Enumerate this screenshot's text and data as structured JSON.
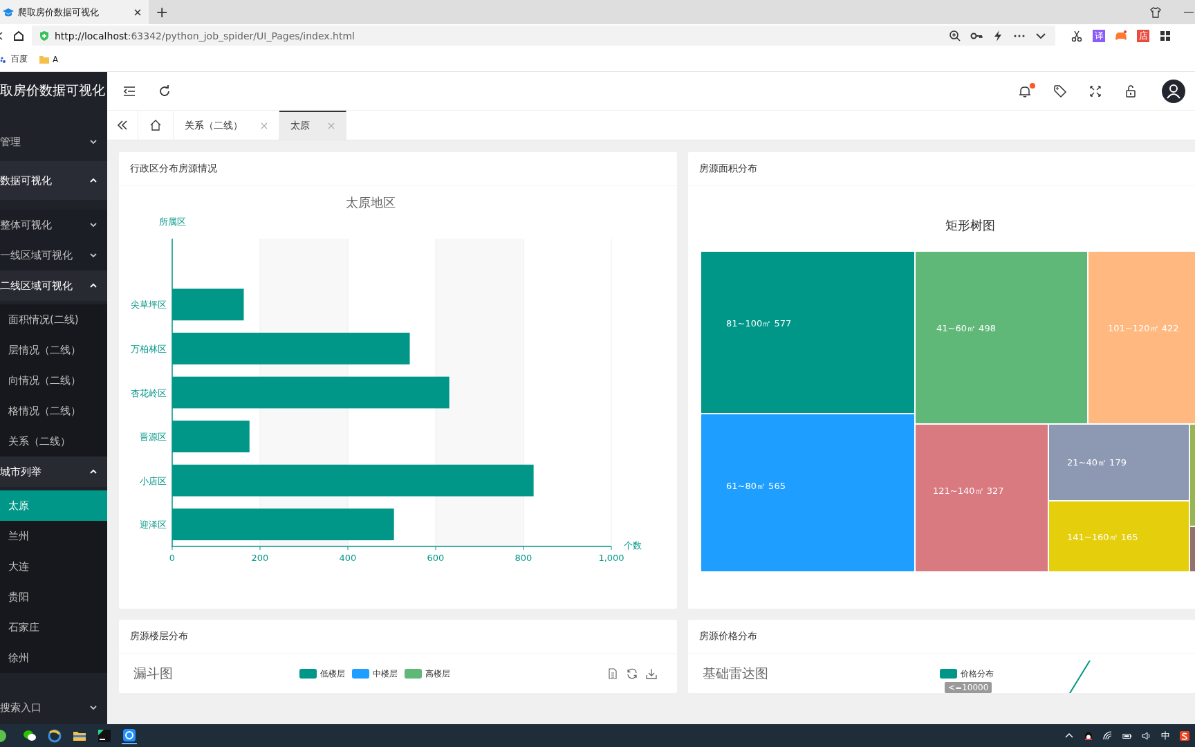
{
  "browser": {
    "tab_title": "爬取房价数据可视化",
    "new_tab": "+",
    "url_host": "http://localhost",
    "url_rest": ":63342/python_job_spider/UI_Pages/index.html",
    "extensions": [
      {
        "kind": "scissors"
      },
      {
        "kind": "text",
        "label": "译",
        "color": "#8b5cf6"
      },
      {
        "kind": "gamepad",
        "color": "#ff7a2f"
      },
      {
        "kind": "text",
        "label": "店",
        "color": "#e84c3d"
      },
      {
        "kind": "grid"
      }
    ],
    "bookmarks": [
      {
        "kind": "paw",
        "label": "百度"
      },
      {
        "kind": "folder",
        "label": "A"
      }
    ]
  },
  "sidebar": {
    "title": "取房价数据可视化",
    "menu": [
      {
        "label": "管理",
        "expanded": false
      },
      {
        "label": "数据可视化",
        "expanded": true,
        "children": [
          {
            "label": "整体可视化",
            "expanded": false
          },
          {
            "label": "一线区域可视化",
            "expanded": false
          },
          {
            "label": "二线区域可视化",
            "expanded": true,
            "children": [
              {
                "label": "面积情况(二线)",
                "selected": false
              },
              {
                "label": "层情况（二线）",
                "selected": false
              },
              {
                "label": "向情况（二线）",
                "selected": false
              },
              {
                "label": "格情况（二线）",
                "selected": false
              },
              {
                "label": "关系（二线）",
                "selected": false
              }
            ]
          },
          {
            "label": "城市列举",
            "expanded": true,
            "children": [
              {
                "label": "太原",
                "selected": true
              },
              {
                "label": "兰州",
                "selected": false
              },
              {
                "label": "大连",
                "selected": false
              },
              {
                "label": "贵阳",
                "selected": false
              },
              {
                "label": "石家庄",
                "selected": false
              },
              {
                "label": "徐州",
                "selected": false
              }
            ]
          }
        ]
      },
      {
        "label": "搜索入口",
        "expanded": false
      }
    ]
  },
  "header": {
    "unread_notifications": true
  },
  "tabs": [
    {
      "label": "关系（二线）",
      "selected": false
    },
    {
      "label": "太原",
      "selected": true
    }
  ],
  "panels": [
    {
      "kind": "bar",
      "title": "行政区分布房源情况",
      "chart_data": {
        "type": "bar",
        "orientation": "horizontal",
        "title": "太原地区",
        "xlabel": "个数",
        "annotations": [
          {
            "text": "所属区"
          }
        ],
        "color": "#009688",
        "categories": [
          "尖草坪区",
          "万柏林区",
          "杏花岭区",
          "晋源区",
          "小店区",
          "迎泽区"
        ],
        "values": [
          163,
          541,
          631,
          176,
          823,
          505
        ],
        "grid": true,
        "xlim": [
          0,
          1000
        ],
        "xticks": [
          0,
          200,
          400,
          600,
          800,
          {
            "value": 1000,
            "label": "1,000"
          }
        ]
      }
    },
    {
      "kind": "treemap",
      "title": "房源面积分布",
      "chart_title": "矩形树图",
      "items": [
        {
          "label": "81~100㎡ 577",
          "color": "#009688"
        },
        {
          "label": "61~80㎡ 565",
          "color": "#1e9fff"
        },
        {
          "label": "41~60㎡ 498",
          "color": "#5fb878"
        },
        {
          "label": "101~120㎡ 422",
          "color": "#ffb980"
        },
        {
          "label": "121~140㎡ 327",
          "color": "#d87a80"
        },
        {
          "label": "21~40㎡ 179",
          "color": "#8d98b3"
        },
        {
          "label": "141~160㎡ 165",
          "color": "#e5cf0d"
        },
        {
          "color": "#97b552"
        },
        {
          "color": "#95706d"
        }
      ]
    },
    {
      "kind": "funnel",
      "title": "房源楼层分布",
      "chart_title": "漏斗图",
      "legend": [
        {
          "label": "低楼层",
          "color": "#009688"
        },
        {
          "label": "中楼层",
          "color": "#1e9fff"
        },
        {
          "label": "高楼层",
          "color": "#5fb878"
        }
      ]
    },
    {
      "kind": "radar",
      "title": "房源价格分布",
      "chart_title": "基础雷达图",
      "legend": [
        {
          "label": "价格分布",
          "color": "#009688"
        }
      ],
      "axis_label": "<=10000"
    }
  ],
  "taskbar": {
    "ime": "中"
  }
}
